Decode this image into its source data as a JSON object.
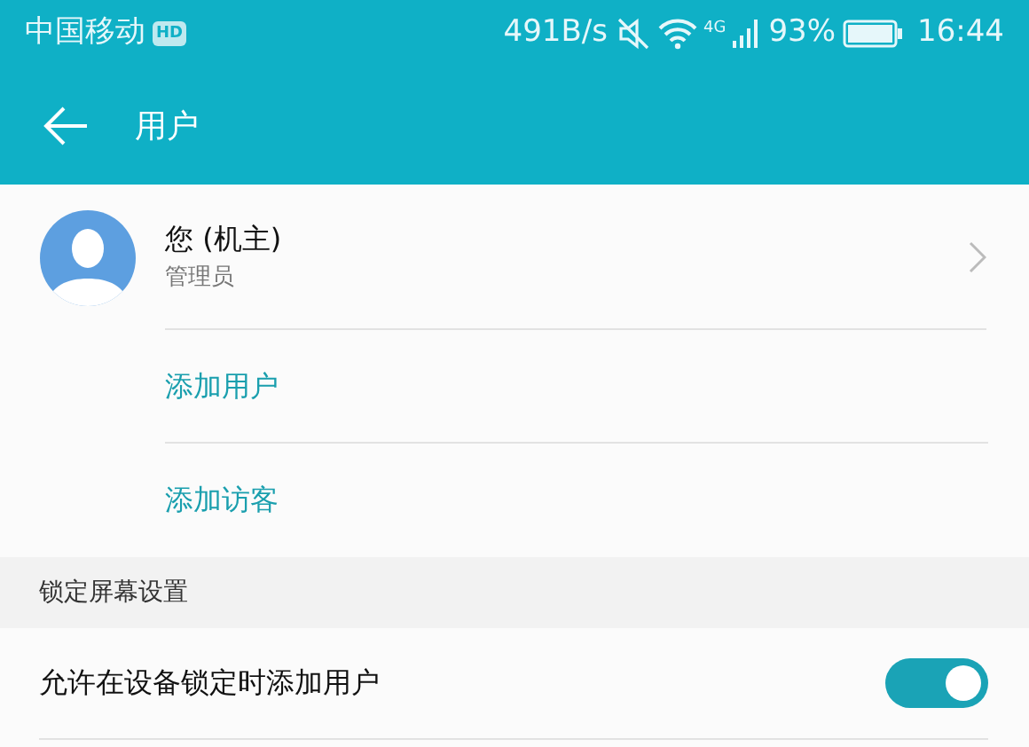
{
  "status_bar": {
    "carrier": "中国移动",
    "hd_badge": "HD",
    "speed": "491B/s",
    "network": "4G",
    "battery": "93%",
    "time": "16:44"
  },
  "app_bar": {
    "title": "用户"
  },
  "owner": {
    "name": "您 (机主)",
    "role": "管理员"
  },
  "actions": [
    {
      "label": "添加用户"
    },
    {
      "label": "添加访客"
    }
  ],
  "section": {
    "title": "锁定屏幕设置"
  },
  "settings": [
    {
      "label": "允许在设备锁定时添加用户",
      "on": true
    }
  ]
}
